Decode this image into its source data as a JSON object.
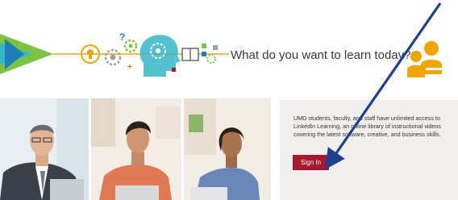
{
  "banner": {
    "title": "What do you want to learn today?",
    "icons": [
      "triangle-logo",
      "lightbulb-icon",
      "gear-icon",
      "person-head-icon",
      "book-icon",
      "people-icon"
    ]
  },
  "info": {
    "text": "UMD students, faculty, and staff have unlimited access to LinkedIn Learning, an online library of instructional videos covering the latest software, creative, and business skills.",
    "sign_in_label": "Sign In"
  },
  "photos": [
    "man-in-suit-photo",
    "young-man-photo",
    "woman-photo"
  ],
  "colors": {
    "accent": "#a6192e",
    "arrow": "#1f3f8f",
    "banner_line": "#f0a500"
  }
}
